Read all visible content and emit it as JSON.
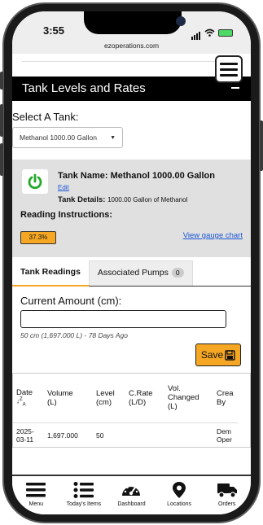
{
  "status_bar": {
    "time": "3:55",
    "url": "ezoperations.com"
  },
  "header": {
    "title": "Tank Levels and Rates"
  },
  "tank_select": {
    "label": "Select A Tank:",
    "selected": "Methanol 1000.00 Gallon"
  },
  "tank_card": {
    "name_label": "Tank Name:",
    "name_value": "Methanol 1000.00 Gallon",
    "edit_link": "Edit",
    "details_label": "Tank Details:",
    "details_value": "1000.00 Gallon of Methanol",
    "reading_instructions_label": "Reading Instructions:",
    "level_percent": "37.3%",
    "gauge_link": "View gauge chart",
    "status_color": "#23a829"
  },
  "tabs": [
    {
      "label": "Tank Readings",
      "active": true
    },
    {
      "label": "Associated Pumps",
      "count": "0",
      "active": false
    }
  ],
  "current_amount": {
    "label": "Current Amount (cm):",
    "value": "",
    "hint": "50 cm (1,697.000 L) - 78 Days Ago",
    "save_label": "Save"
  },
  "readings_table": {
    "headers": [
      {
        "line1": "Date",
        "line2": ""
      },
      {
        "line1": "Volume",
        "line2": "(L)"
      },
      {
        "line1": "Level",
        "line2": "(cm)"
      },
      {
        "line1": "C.Rate",
        "line2": "(L/D)"
      },
      {
        "line1": "Vol.",
        "line2": "Changed",
        "line3": "(L)"
      },
      {
        "line1": "Crea",
        "line2": "By"
      }
    ],
    "rows": [
      {
        "date1": "2025-",
        "date2": "03-11",
        "volume": "1,697.000",
        "level": "50",
        "rate": "",
        "changed": "",
        "by1": "Dem",
        "by2": "Oper"
      }
    ]
  },
  "bottom_nav": [
    {
      "label": "Menu",
      "icon": "menu-icon"
    },
    {
      "label": "Today's Items",
      "icon": "list-icon"
    },
    {
      "label": "Dashboard",
      "icon": "dashboard-gauge-icon"
    },
    {
      "label": "Locations",
      "icon": "map-pin-icon"
    },
    {
      "label": "Orders",
      "icon": "truck-icon"
    }
  ],
  "colors": {
    "accent": "#f5a623",
    "link": "#1a55d6",
    "header_bg": "#000000"
  }
}
